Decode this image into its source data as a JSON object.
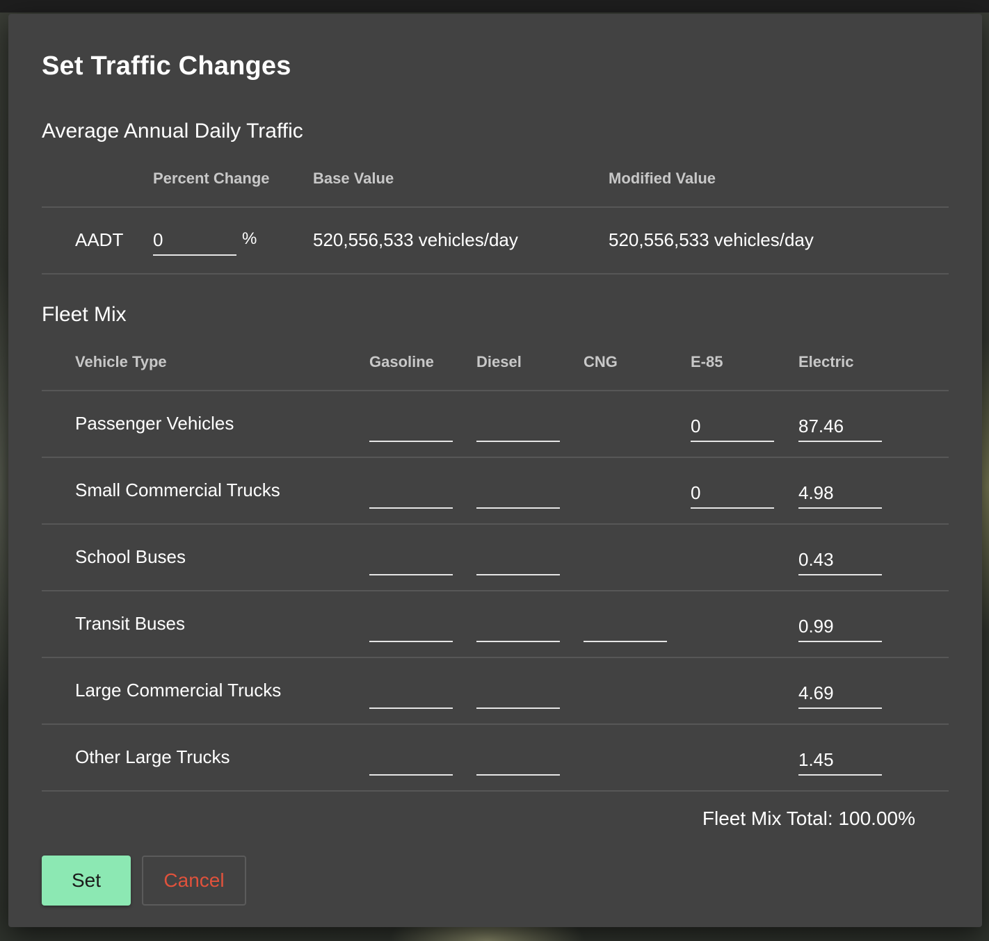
{
  "dialog": {
    "title": "Set Traffic Changes",
    "aadt_section": {
      "title": "Average Annual Daily Traffic",
      "headers": {
        "percent_change": "Percent Change",
        "base_value": "Base Value",
        "modified_value": "Modified Value"
      },
      "row": {
        "label": "AADT",
        "percent_value": "0",
        "percent_unit": "%",
        "base_value": "520,556,533 vehicles/day",
        "modified_value": "520,556,533 vehicles/day"
      }
    },
    "fleet_section": {
      "title": "Fleet Mix",
      "headers": {
        "vehicle_type": "Vehicle Type",
        "gasoline": "Gasoline",
        "diesel": "Diesel",
        "cng": "CNG",
        "e85": "E-85",
        "electric": "Electric"
      },
      "rows": [
        {
          "label": "Passenger Vehicles",
          "gasoline": "",
          "diesel": "",
          "e85": "0",
          "electric": "87.46"
        },
        {
          "label": "Small Commercial Trucks",
          "gasoline": "",
          "diesel": "",
          "e85": "0",
          "electric": "4.98"
        },
        {
          "label": "School Buses",
          "gasoline": "",
          "diesel": "",
          "electric": "0.43"
        },
        {
          "label": "Transit Buses",
          "gasoline": "",
          "diesel": "",
          "cng": "",
          "electric": "0.99"
        },
        {
          "label": "Large Commercial Trucks",
          "gasoline": "",
          "diesel": "",
          "electric": "4.69"
        },
        {
          "label": "Other Large Trucks",
          "gasoline": "",
          "diesel": "",
          "electric": "1.45"
        }
      ],
      "total_text": "Fleet Mix Total: 100.00%"
    },
    "buttons": {
      "set_label": "Set",
      "cancel_label": "Cancel"
    }
  },
  "colors": {
    "dialog_bg": "#424242",
    "set_button": "#8ce8b3",
    "cancel_text": "#e0523c"
  }
}
